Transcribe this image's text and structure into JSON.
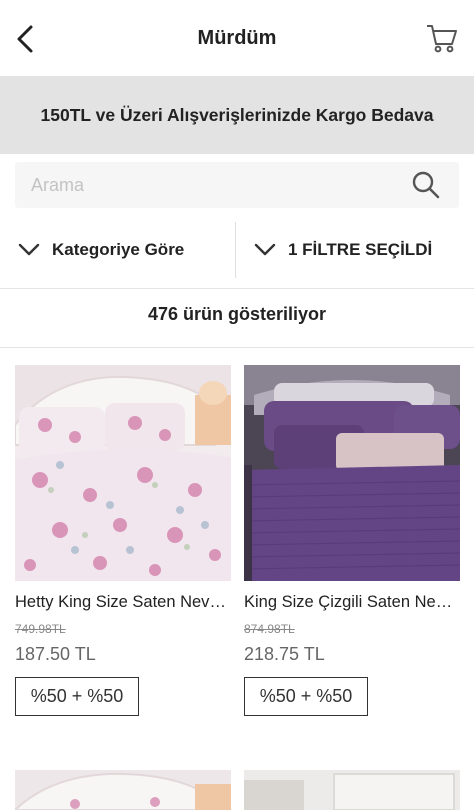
{
  "header": {
    "title": "Mürdüm",
    "back_icon": "chevron-left-icon",
    "cart_icon": "cart-icon"
  },
  "banner": {
    "text": "150TL ve Üzeri Alışverişlerinizde Kargo Bedava"
  },
  "search": {
    "placeholder": "Arama",
    "value": "",
    "icon": "search-icon"
  },
  "filters": {
    "category_label": "Kategoriye Göre",
    "filter_label": "1 FİLTRE SEÇİLDİ"
  },
  "results": {
    "count_text": "476 ürün gösteriliyor"
  },
  "products": [
    {
      "name": "Hetty King Size Saten Nevresim Takımı",
      "old_price": "749.98TL",
      "price": "187.50 TL",
      "badge": "%50 + %50"
    },
    {
      "name": "King Size Çizgili Saten Nevresim Takımı",
      "old_price": "874.98TL",
      "price": "218.75 TL",
      "badge": "%50 + %50"
    }
  ],
  "colors": {
    "banner_bg": "#e3e3e3",
    "search_bg": "#f6f6f6",
    "text": "#222222",
    "price": "#666666"
  }
}
